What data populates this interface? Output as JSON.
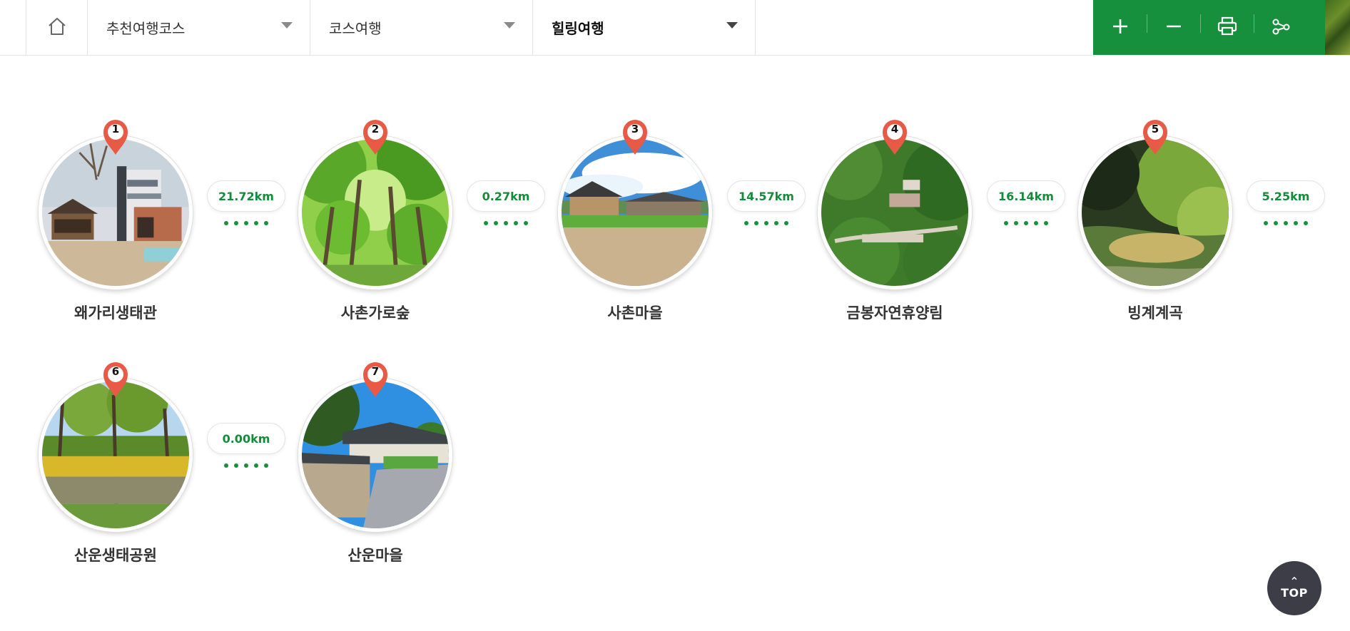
{
  "nav": {
    "home_icon": "home-icon",
    "dropdowns": [
      {
        "label": "추천여행코스"
      },
      {
        "label": "코스여행"
      },
      {
        "label": "힐링여행"
      }
    ],
    "tools": [
      "plus-icon",
      "minus-icon",
      "print-icon",
      "share-icon"
    ],
    "accent": "#16903c"
  },
  "course": [
    {
      "number": "1",
      "name": "왜가리생태관",
      "distance_next": "21.72km"
    },
    {
      "number": "2",
      "name": "사촌가로숲",
      "distance_next": "0.27km"
    },
    {
      "number": "3",
      "name": "사촌마을",
      "distance_next": "14.57km"
    },
    {
      "number": "4",
      "name": "금봉자연휴양림",
      "distance_next": "16.14km"
    },
    {
      "number": "5",
      "name": "빙계계곡",
      "distance_next": "5.25km"
    },
    {
      "number": "6",
      "name": "산운생태공원",
      "distance_next": "0.00km"
    },
    {
      "number": "7",
      "name": "산운마을"
    }
  ],
  "top_button": {
    "label": "TOP"
  },
  "colors": {
    "pin": "#e85a45",
    "distance_text": "#138c3a",
    "top_button": "#3c3d47"
  }
}
